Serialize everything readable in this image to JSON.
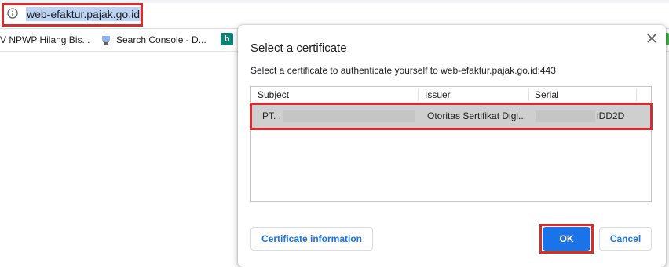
{
  "browser": {
    "url": "web-efaktur.pajak.go.id",
    "bookmarks": [
      {
        "label": "V NPWP Hilang Bis..."
      },
      {
        "label": "Search Console - D..."
      },
      {
        "label": "b"
      }
    ]
  },
  "dialog": {
    "title": "Select a certificate",
    "description": "Select a certificate to authenticate yourself to web-efaktur.pajak.go.id:443",
    "columns": [
      "Subject",
      "Issuer",
      "Serial"
    ],
    "rows": [
      {
        "subject": "PT. .",
        "issuer": "Otoritas Sertifikat Digi...",
        "serial": "iDD2D"
      }
    ],
    "buttons": {
      "certificate_info": "Certificate information",
      "ok": "OK",
      "cancel": "Cancel"
    }
  },
  "colors": {
    "accent": "#1a73e8",
    "highlight_box": "#d32f2f",
    "selected_row": "#cfcfcf"
  }
}
